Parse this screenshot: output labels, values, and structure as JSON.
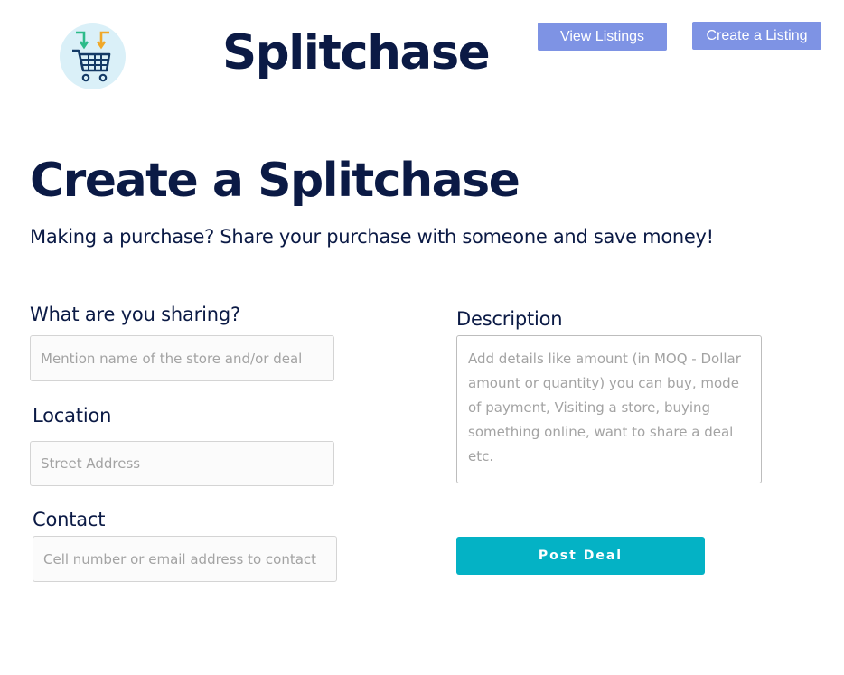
{
  "header": {
    "logo_icon": "shopping-cart-split-icon",
    "brand": "Splitchase",
    "nav": {
      "view_listings": "View Listings",
      "create_listing": "Create a Listing"
    }
  },
  "page": {
    "title": "Create a Splitchase",
    "subtitle": "Making a purchase? Share your purchase with someone and save money!"
  },
  "form": {
    "sharing": {
      "label": "What are you sharing?",
      "placeholder": "Mention name of the store and/or deal",
      "value": ""
    },
    "location": {
      "label": "Location",
      "placeholder": "Street Address",
      "value": ""
    },
    "contact": {
      "label": "Contact",
      "placeholder": "Cell number or email address to contact",
      "value": ""
    },
    "description": {
      "label": "Description",
      "placeholder": "Add details like amount (in MOQ - Dollar amount or quantity) you can buy, mode of payment, Visiting a store, buying something online, want to share a deal etc.",
      "value": ""
    },
    "submit_label": "Post Deal"
  },
  "colors": {
    "navy": "#0b1a45",
    "nav_button": "#7e93e4",
    "post_button": "#04b2c5",
    "logo_bg": "#daf0f8"
  }
}
